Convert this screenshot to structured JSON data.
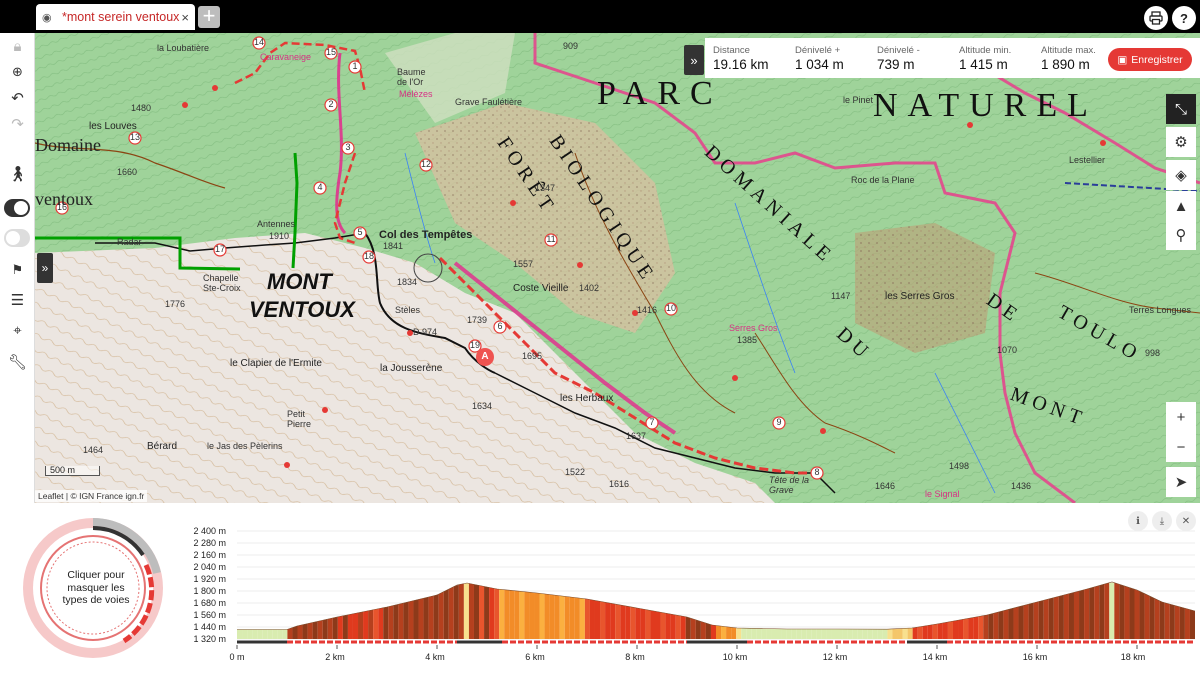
{
  "tab": {
    "title": "*mont serein ventoux",
    "close": "×"
  },
  "newtab": "+",
  "topbar": {
    "print_icon": "printer-icon",
    "help_icon": "help-icon",
    "help_label": "?"
  },
  "left_toolbar": {
    "icons": [
      "lock-icon",
      "zoom-icon",
      "undo-icon",
      "redo-icon",
      "walker-icon",
      "toggle-on",
      "eye-off-icon",
      "flag-icon",
      "layers-list-icon",
      "pin-icon",
      "wrench-icon"
    ]
  },
  "stats": {
    "distance": {
      "label": "Distance",
      "value": "19.16 km"
    },
    "gain": {
      "label": "Dénivelé +",
      "value": "1 034 m"
    },
    "loss": {
      "label": "Dénivelé -",
      "value": "739 m"
    },
    "alt_min": {
      "label": "Altitude min.",
      "value": "1 415 m"
    },
    "alt_max": {
      "label": "Altitude max.",
      "value": "1 890 m"
    },
    "save": "Enregistrer"
  },
  "map_labels": {
    "parc": "PARC",
    "naturel": "NATUREL",
    "foret": "FORÊT",
    "biologique": "BIOLOGIQUE",
    "domaniale": "DOMANIALE",
    "du": "DU",
    "de": "DE",
    "toulo": "TOULO",
    "mont": "MONT",
    "mont_ventoux_1": "MONT",
    "mont_ventoux_2": "VENTOUX",
    "col_tempetes": "Col des Tempêtes",
    "coste_vieille": "Coste Vieille",
    "les_serres_gros": "les Serres Gros",
    "serres_gros": "Serres Gros",
    "la_jousserene": "la Jousserène",
    "les_herbaux": "les Herbaux",
    "clapier": "le Clapier de l'Ermite",
    "berard": "Bérard",
    "jas_pelerins": "le Jas des Pèlerins",
    "petit_pierre": "Petit Pierre",
    "chapelle": "Chapelle Ste-Croix",
    "radar": "Radar",
    "les_louves": "les Louves",
    "loubatiere": "la Loubatière",
    "grave_fauletiere": "Grave Faulétière",
    "baume": "Baume de l'Or",
    "melezes": "Mélèzes",
    "le_pinet": "le Pinet",
    "roc_plane": "Roc de la Plane",
    "lestellier": "Lestellier",
    "terres_longues": "Terres Longues",
    "tete_grave": "Tête de la Grave",
    "le_signal": "le Signal",
    "domaine": "Domaine",
    "ventoux_left": "ventoux",
    "steles": "Stèles",
    "caravaneige": "Caravaneige",
    "antennes": "Antennes",
    "d974": "D 974",
    "alt_1910": "1910",
    "alt_1841": "1841",
    "alt_1834": "1834",
    "alt_1739": "1739",
    "alt_1695": "1695",
    "alt_1776": "1776",
    "alt_1634": "1634",
    "alt_1637": "1637",
    "alt_1522": "1522",
    "alt_1616": "1616",
    "alt_1402": "1402",
    "alt_1416": "1416",
    "alt_1385": "1385",
    "alt_1147": "1147",
    "alt_1070": "1070",
    "alt_998": "998",
    "alt_1498": "1498",
    "alt_1646": "1646",
    "alt_1436": "1436",
    "alt_1660": "1660",
    "alt_1464": "1464",
    "alt_1480": "1480",
    "alt_1347": "1347",
    "alt_1557": "1557",
    "alt_909": "909",
    "marker_a": "A",
    "waypoints": [
      "14",
      "15",
      "1",
      "2",
      "3",
      "4",
      "5",
      "6",
      "7",
      "8",
      "9",
      "10",
      "11",
      "12",
      "13",
      "16",
      "17",
      "18",
      "19"
    ]
  },
  "map_tools": [
    "collapse-icon",
    "settings-icon",
    "layers-icon",
    "mountain-icon",
    "person-pin-icon",
    "zoom-in-icon",
    "zoom-out-icon",
    "locate-icon"
  ],
  "zoom_in": "+",
  "zoom_out": "−",
  "scale": "500 m",
  "attribution": "Leaflet | © IGN France ign.fr",
  "profile": {
    "donut_text": "Cliquer pour masquer les types de voies",
    "y_ticks": [
      "2 400 m",
      "2 280 m",
      "2 160 m",
      "2 040 m",
      "1 920 m",
      "1 800 m",
      "1 680 m",
      "1 560 m",
      "1 440 m",
      "1 320 m"
    ],
    "x_ticks": [
      "0 m",
      "2 km",
      "4 km",
      "6 km",
      "8 km",
      "10 km",
      "12 km",
      "14 km",
      "16 km",
      "18 km"
    ],
    "info_icon": "info-icon",
    "download_icon": "download-icon",
    "close_icon": "close-icon"
  },
  "chart_data": {
    "type": "area",
    "title": "",
    "xlabel": "",
    "ylabel": "",
    "x_unit": "km",
    "y_unit": "m",
    "xlim": [
      0,
      19.16
    ],
    "ylim": [
      1320,
      2400
    ],
    "x": [
      0,
      0.3,
      1.0,
      1.2,
      2.0,
      3.0,
      4.0,
      4.4,
      4.6,
      5.2,
      6.0,
      7.0,
      8.0,
      9.0,
      9.5,
      10.0,
      11.0,
      12.0,
      13.0,
      13.5,
      14.0,
      15.0,
      16.0,
      17.0,
      17.5,
      18.0,
      18.5,
      19.16
    ],
    "series": [
      {
        "values": [
          1415,
          1415,
          1415,
          1450,
          1540,
          1640,
          1760,
          1860,
          1880,
          1820,
          1780,
          1720,
          1630,
          1540,
          1460,
          1430,
          1420,
          1420,
          1418,
          1430,
          1470,
          1560,
          1690,
          1820,
          1890,
          1810,
          1690,
          1600
        ]
      }
    ]
  }
}
